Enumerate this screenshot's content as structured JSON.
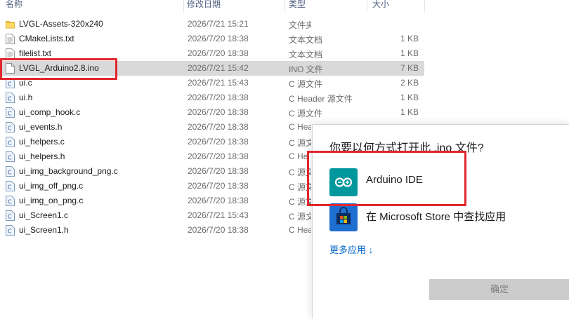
{
  "columns": {
    "name": "名称",
    "date": "修改日期",
    "type": "类型",
    "size": "大小"
  },
  "files": [
    {
      "name": "LVGL-Assets-320x240",
      "date": "2026/7/21 15:21",
      "type": "文件夹",
      "size": "",
      "icon": "folder-icon",
      "selected": false
    },
    {
      "name": "CMakeLists.txt",
      "date": "2026/7/20 18:38",
      "type": "文本文档",
      "size": "1 KB",
      "icon": "text-file-icon",
      "selected": false
    },
    {
      "name": "filelist.txt",
      "date": "2026/7/20 18:38",
      "type": "文本文档",
      "size": "1 KB",
      "icon": "text-file-icon",
      "selected": false
    },
    {
      "name": "LVGL_Arduino2.8.ino",
      "date": "2026/7/21 15:42",
      "type": "INO 文件",
      "size": "7 KB",
      "icon": "blank-file-icon",
      "selected": true
    },
    {
      "name": "ui.c",
      "date": "2026/7/21 15:43",
      "type": "C 源文件",
      "size": "2 KB",
      "icon": "c-file-icon",
      "selected": false
    },
    {
      "name": "ui.h",
      "date": "2026/7/20 18:38",
      "type": "C Header 源文件",
      "size": "1 KB",
      "icon": "c-file-icon",
      "selected": false
    },
    {
      "name": "ui_comp_hook.c",
      "date": "2026/7/20 18:38",
      "type": "C 源文件",
      "size": "1 KB",
      "icon": "c-file-icon",
      "selected": false
    },
    {
      "name": "ui_events.h",
      "date": "2026/7/20 18:38",
      "type": "C Hea",
      "size": "",
      "icon": "c-file-icon",
      "selected": false
    },
    {
      "name": "ui_helpers.c",
      "date": "2026/7/20 18:38",
      "type": "C 源文",
      "size": "",
      "icon": "c-file-icon",
      "selected": false
    },
    {
      "name": "ui_helpers.h",
      "date": "2026/7/20 18:38",
      "type": "C He",
      "size": "",
      "icon": "c-file-icon",
      "selected": false
    },
    {
      "name": "ui_img_background_png.c",
      "date": "2026/7/20 18:38",
      "type": "C 源文",
      "size": "",
      "icon": "c-file-icon",
      "selected": false
    },
    {
      "name": "ui_img_off_png.c",
      "date": "2026/7/20 18:38",
      "type": "C 源文",
      "size": "",
      "icon": "c-file-icon",
      "selected": false
    },
    {
      "name": "ui_img_on_png.c",
      "date": "2026/7/20 18:38",
      "type": "C 源文",
      "size": "",
      "icon": "c-file-icon",
      "selected": false
    },
    {
      "name": "ui_Screen1.c",
      "date": "2026/7/21 15:43",
      "type": "C 源文",
      "size": "",
      "icon": "c-file-icon",
      "selected": false
    },
    {
      "name": "ui_Screen1.h",
      "date": "2026/7/20 18:38",
      "type": "C Hea",
      "size": "",
      "icon": "c-file-icon",
      "selected": false
    }
  ],
  "dialog": {
    "title": "你要以何方式打开此 .ino 文件?",
    "apps": [
      {
        "label": "Arduino IDE",
        "icon": "arduino-ide-icon"
      },
      {
        "label": "在 Microsoft Store 中查找应用",
        "icon": "microsoft-store-icon"
      }
    ],
    "more_apps": "更多应用 ↓",
    "ok": "确定"
  },
  "colors": {
    "highlight": "#e0262e",
    "selected_row": "#d9d9d9",
    "arduino": "#00979d",
    "link": "#0066cc"
  }
}
